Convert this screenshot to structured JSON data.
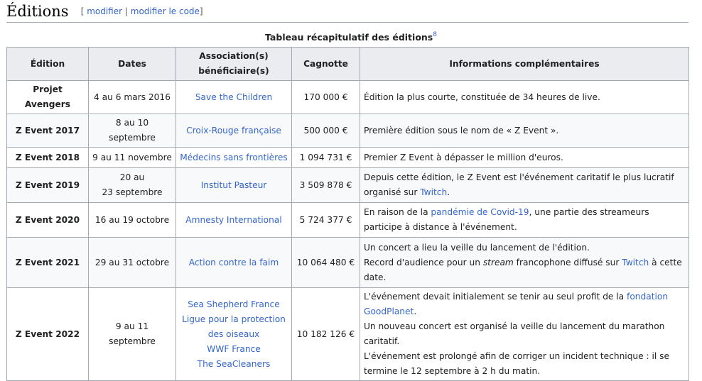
{
  "section": {
    "title": "Éditions",
    "edit_open": "[",
    "edit_link": "modifier",
    "edit_sep": "|",
    "edit_code_link": "modifier le code",
    "edit_close": "]"
  },
  "table": {
    "caption": "Tableau récapitulatif des éditions",
    "caption_ref": "8",
    "headers": {
      "edition": "Édition",
      "dates": "Dates",
      "assoc_line1": "Association(s)",
      "assoc_line2": "bénéficiaire(s)",
      "cagnotte": "Cagnotte",
      "info": "Informations complémentaires"
    },
    "rows": [
      {
        "edition": "Projet Avengers",
        "dates": "4 au 6 mars 2016",
        "assoc": "Save the Children",
        "cagnotte": "170 000 €",
        "info": "Édition la plus courte, constituée de 34 heures de live."
      },
      {
        "edition": "Z Event 2017",
        "dates": "8 au 10 septembre",
        "assoc": "Croix-Rouge française",
        "cagnotte": "500 000 €",
        "info": "Première édition sous le nom de « Z Event »."
      },
      {
        "edition": "Z Event 2018",
        "dates": "9 au 11 novembre",
        "assoc": "Médecins sans frontières",
        "cagnotte": "1 094 731 €",
        "info": "Premier Z Event à dépasser le million d'euros."
      },
      {
        "edition": "Z Event 2019",
        "dates_line1": "20 au",
        "dates_line2": "23 septembre",
        "assoc": "Institut Pasteur",
        "cagnotte": "3 509 878 €",
        "info_a": "Depuis cette édition, le Z Event est l'événement caritatif le plus lucratif organisé sur ",
        "info_link": "Twitch",
        "info_b": "."
      },
      {
        "edition": "Z Event 2020",
        "dates": "16 au 19 octobre",
        "assoc": "Amnesty International",
        "cagnotte": "5 724 377 €",
        "info_a": "En raison de la ",
        "info_link": "pandémie de Covid-19",
        "info_b": ", une partie des streameurs participe à distance à l'événement."
      },
      {
        "edition": "Z Event 2021",
        "dates": "29 au 31 octobre",
        "assoc": "Action contre la faim",
        "cagnotte": "10 064 480 €",
        "info_line1": "Un concert a lieu la veille du lancement de l'édition.",
        "info_a": "Record d'audience pour un ",
        "info_em": "stream",
        "info_b": " francophone diffusé sur ",
        "info_link": "Twitch",
        "info_c": " à cette date."
      },
      {
        "edition": "Z Event 2022",
        "dates": "9 au 11 septembre",
        "assoc_list": [
          "Sea Shepherd France",
          "Ligue pour la protection des oiseaux",
          "WWF France",
          "The SeaCleaners"
        ],
        "cagnotte": "10 182 126 €",
        "info_a": "L'événement devait initialement se tenir au seul profit de la ",
        "info_link": "fondation GoodPlanet",
        "info_b": ".",
        "info_line2": "Un nouveau concert est organisé la veille du lancement du marathon caritatif.",
        "info_line3": "L'événement est prolongé afin de corriger un incident technique : il se termine le 12 septembre à 2 h du matin."
      }
    ]
  }
}
